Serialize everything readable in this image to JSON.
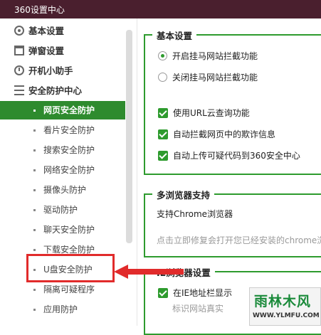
{
  "window": {
    "title": "360设置中心"
  },
  "sidebar": {
    "categories": [
      {
        "label": "基本设置",
        "icon": "gear-icon"
      },
      {
        "label": "弹窗设置",
        "icon": "window-icon"
      },
      {
        "label": "开机小助手",
        "icon": "clock-icon"
      },
      {
        "label": "安全防护中心",
        "icon": "list-icon"
      }
    ],
    "items": [
      {
        "label": "网页安全防护",
        "active": true
      },
      {
        "label": "看片安全防护"
      },
      {
        "label": "搜索安全防护"
      },
      {
        "label": "网络安全防护"
      },
      {
        "label": "摄像头防护"
      },
      {
        "label": "驱动防护"
      },
      {
        "label": "聊天安全防护"
      },
      {
        "label": "下载安全防护"
      },
      {
        "label": "U盘安全防护"
      },
      {
        "label": "隔离可疑程序"
      },
      {
        "label": "应用防护"
      }
    ]
  },
  "main": {
    "basic": {
      "title": "基本设置",
      "radio_on": "开启挂马网站拦截功能",
      "radio_off": "关闭挂马网站拦截功能",
      "check1": "使用URL云查询功能",
      "check2": "自动拦截网页中的欺诈信息",
      "check3": "自动上传可疑代码到360安全中心"
    },
    "multi": {
      "title": "多浏览器支持",
      "desc": "支持Chrome浏览器",
      "hint": "点击立即修复会打开您已经安装的chrome浏"
    },
    "ie": {
      "title": "IE浏览器设置",
      "check1": "在IE地址栏显示",
      "hint": "标识网站真实"
    }
  },
  "watermark": {
    "logo": "雨林木风",
    "url": "WWW.YLMFU.COM"
  },
  "colors": {
    "accent": "#2e9b2e",
    "highlight": "#e12b2b",
    "titlebar": "#4a1f2e"
  }
}
